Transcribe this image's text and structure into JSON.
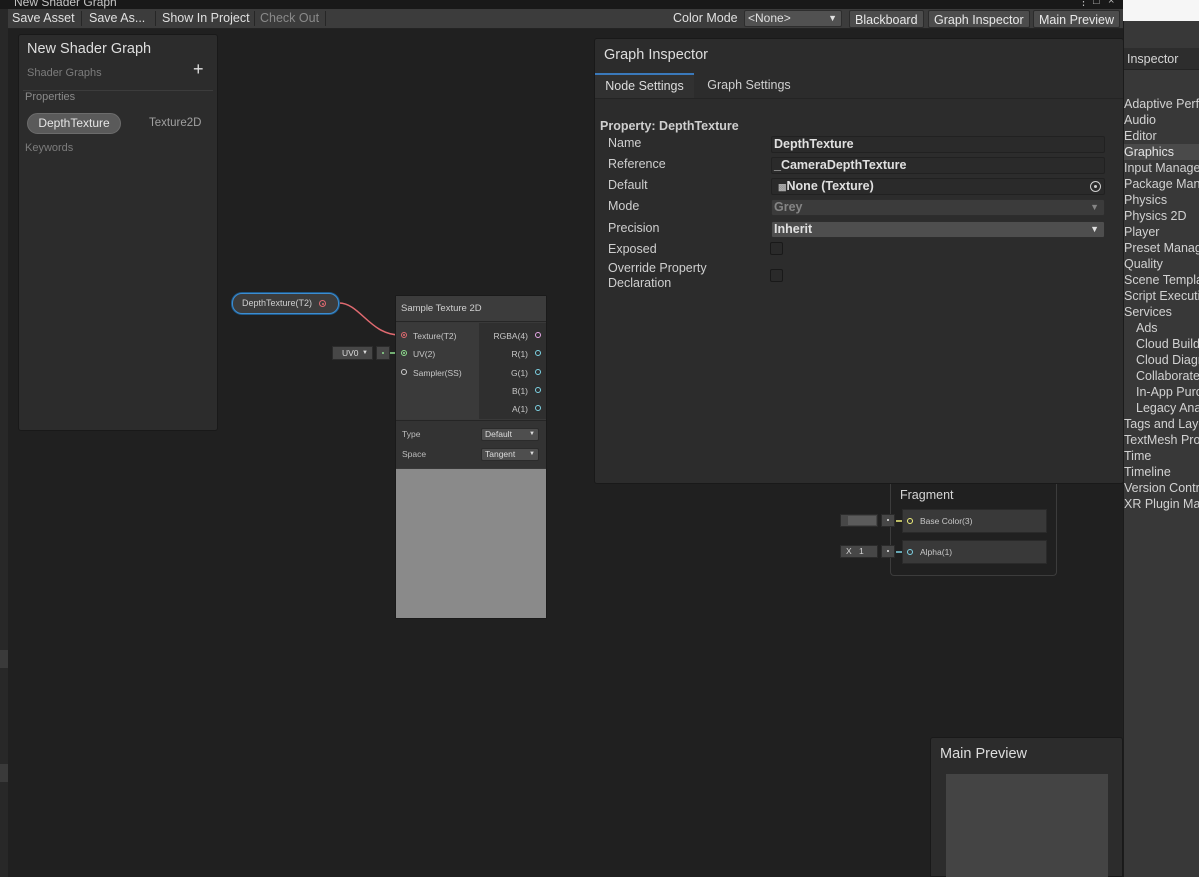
{
  "window": {
    "title": "New Shader Graph"
  },
  "toolbar": {
    "save_asset": "Save Asset",
    "save_as": "Save As...",
    "show_in_project": "Show In Project",
    "check_out": "Check Out",
    "color_mode_label": "Color Mode",
    "color_mode_value": "<None>",
    "blackboard": "Blackboard",
    "graph_inspector": "Graph Inspector",
    "main_preview": "Main Preview"
  },
  "blackboard": {
    "title": "New Shader Graph",
    "subtitle": "Shader Graphs",
    "add_glyph": "+",
    "properties_header": "Properties",
    "property": {
      "name": "DepthTexture",
      "type": "Texture2D"
    },
    "keywords_header": "Keywords"
  },
  "property_node": {
    "label": "DepthTexture(T2)"
  },
  "sample_node": {
    "title": "Sample Texture 2D",
    "inputs": [
      "Texture(T2)",
      "UV(2)",
      "Sampler(SS)"
    ],
    "outputs": [
      "RGBA(4)",
      "R(1)",
      "G(1)",
      "B(1)",
      "A(1)"
    ],
    "settings": [
      {
        "label": "Type",
        "value": "Default"
      },
      {
        "label": "Space",
        "value": "Tangent"
      }
    ],
    "uv_dropdown": "UV0"
  },
  "graph_inspector": {
    "title": "Graph Inspector",
    "tabs": [
      "Node Settings",
      "Graph Settings"
    ],
    "property_header": "Property: DepthTexture",
    "fields": {
      "name_label": "Name",
      "name_value": "DepthTexture",
      "reference_label": "Reference",
      "reference_value": "_CameraDepthTexture",
      "default_label": "Default",
      "default_value": "None (Texture)",
      "mode_label": "Mode",
      "mode_value": "Grey",
      "precision_label": "Precision",
      "precision_value": "Inherit",
      "exposed_label": "Exposed",
      "override_label_line1": "Override Property",
      "override_label_line2": "Declaration"
    }
  },
  "fragment": {
    "title": "Fragment",
    "base_color": "Base Color(3)",
    "alpha": "Alpha(1)",
    "alpha_axis": "X",
    "alpha_value": "1"
  },
  "main_preview": {
    "title": "Main Preview"
  },
  "right_inspector": {
    "tab": "Inspector",
    "items": [
      {
        "label": "Adaptive Performance",
        "indent": 0,
        "selected": false
      },
      {
        "label": "Audio",
        "indent": 0,
        "selected": false
      },
      {
        "label": "Editor",
        "indent": 0,
        "selected": false
      },
      {
        "label": "Graphics",
        "indent": 0,
        "selected": true
      },
      {
        "label": "Input Manager",
        "indent": 0,
        "selected": false
      },
      {
        "label": "Package Manager",
        "indent": 0,
        "selected": false
      },
      {
        "label": "Physics",
        "indent": 0,
        "selected": false
      },
      {
        "label": "Physics 2D",
        "indent": 0,
        "selected": false
      },
      {
        "label": "Player",
        "indent": 0,
        "selected": false
      },
      {
        "label": "Preset Manager",
        "indent": 0,
        "selected": false
      },
      {
        "label": "Quality",
        "indent": 0,
        "selected": false
      },
      {
        "label": "Scene Template",
        "indent": 0,
        "selected": false
      },
      {
        "label": "Script Execution",
        "indent": 0,
        "selected": false
      },
      {
        "label": "Services",
        "indent": 0,
        "selected": false
      },
      {
        "label": "Ads",
        "indent": 1,
        "selected": false
      },
      {
        "label": "Cloud Build",
        "indent": 1,
        "selected": false
      },
      {
        "label": "Cloud Diagnostics",
        "indent": 1,
        "selected": false
      },
      {
        "label": "Collaborate",
        "indent": 1,
        "selected": false
      },
      {
        "label": "In-App Purchasing",
        "indent": 1,
        "selected": false
      },
      {
        "label": "Legacy Analytics",
        "indent": 1,
        "selected": false
      },
      {
        "label": "Tags and Layers",
        "indent": 0,
        "selected": false
      },
      {
        "label": "TextMesh Pro",
        "indent": 0,
        "selected": false
      },
      {
        "label": "Time",
        "indent": 0,
        "selected": false
      },
      {
        "label": "Timeline",
        "indent": 0,
        "selected": false
      },
      {
        "label": "Version Control",
        "indent": 0,
        "selected": false
      },
      {
        "label": "XR Plugin Management",
        "indent": 0,
        "selected": false
      }
    ]
  },
  "colors": {
    "texture_port": "#e06a70",
    "vector2_port": "#8ede8e",
    "float_port": "#7ed4e6",
    "selection": "#3d8dd0"
  }
}
